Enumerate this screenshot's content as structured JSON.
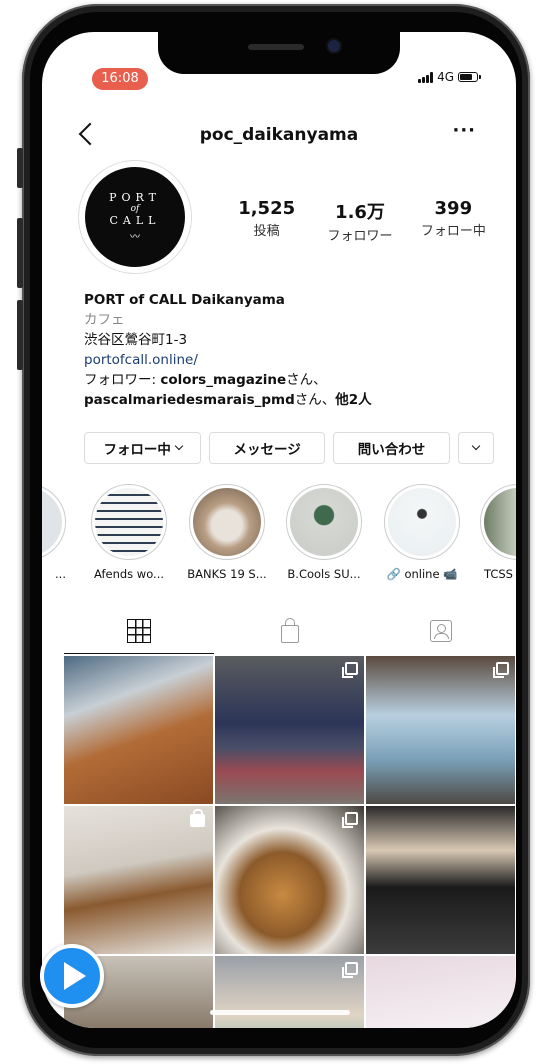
{
  "status": {
    "time": "16:08",
    "network": "4G",
    "signal_bars": 4,
    "battery_level": 0.7
  },
  "header": {
    "username": "poc_daikanyama",
    "back_icon": "chevron-left-icon",
    "more_label": "···"
  },
  "avatar": {
    "line1": "PORT",
    "line2": "of",
    "line3": "CALL",
    "wave": "〰"
  },
  "stats": [
    {
      "value": "1,525",
      "label": "投稿"
    },
    {
      "value": "1.6万",
      "label": "フォロワー"
    },
    {
      "value": "399",
      "label": "フォロー中"
    }
  ],
  "bio": {
    "name": "PORT of CALL Daikanyama",
    "category": "カフェ",
    "address": "渋谷区鶯谷町1-3",
    "link": "portofcall.online/",
    "followed_prefix": "フォロワー: ",
    "followed_user1": "colors_magazine",
    "followed_mid": "さん、",
    "followed_user2": "pascalmariedesmarais_pmd",
    "followed_suffix_a": "さん、",
    "followed_suffix_b": "他2人"
  },
  "actions": {
    "follow": "フォロー中",
    "message": "メッセージ",
    "contact": "問い合わせ"
  },
  "highlights": [
    {
      "caption": "Afends wo...",
      "color": "#c9d4dc"
    },
    {
      "caption": "BANKS 19 S...",
      "color": "#b89e84"
    },
    {
      "caption": "B.Cools SU...",
      "color": "#d4d7d2"
    },
    {
      "caption": "🔗 online 📹",
      "color": "#f3f6f7"
    },
    {
      "caption": "TCSS",
      "color": "#8a9a7f"
    }
  ],
  "tabs": {
    "grid_icon": "grid-icon",
    "shop_icon": "shopping-bag-icon",
    "tagged_icon": "tagged-person-icon"
  },
  "photos": [
    {
      "kind": "single",
      "bg": "linear-gradient(160deg,#4e6a82 0%,#c8cfd5 30%,#b26c38 55%,#8a4a22 100%)"
    },
    {
      "kind": "multi",
      "bg": "linear-gradient(180deg,#5a5c5f 0%,#2c3558 45%,#4a4e68 62%,#9a4a52 78%,#7c7670 100%)"
    },
    {
      "kind": "multi",
      "bg": "linear-gradient(180deg,#5a4a3e 0%,#b8cfe0 40%,#7aa0b8 70%,#4e4a44 100%)"
    },
    {
      "kind": "shop",
      "bg": "linear-gradient(170deg,#e6e2dc 0%,#cfc9c0 40%,#8a5a30 60%,#e9e6e1 100%)"
    },
    {
      "kind": "multi",
      "bg": "radial-gradient(circle at 45% 60%,#c98a42 0%,#8c5a2a 35%,#e8e4dc 55%,#3a3530 100%)"
    },
    {
      "kind": "single",
      "bg": "linear-gradient(180deg,#2a2a2a 0%,#d8c8b4 30%,#1a1a1a 55%,#3c3c3c 100%)"
    },
    {
      "kind": "single",
      "bg": "linear-gradient(180deg,#c8c2b8 0%,#7a6a5a 60%,#3a2e26 100%)"
    },
    {
      "kind": "multi",
      "bg": "linear-gradient(180deg,#9aa0a8 0%,#e0d4c4 40%,#7fb8a8 70%,#5a6a7a 100%)"
    },
    {
      "kind": "single",
      "bg": "linear-gradient(170deg,#e8d8e0 0%,#f4eef2 50%,#d8c6d2 100%)"
    }
  ]
}
